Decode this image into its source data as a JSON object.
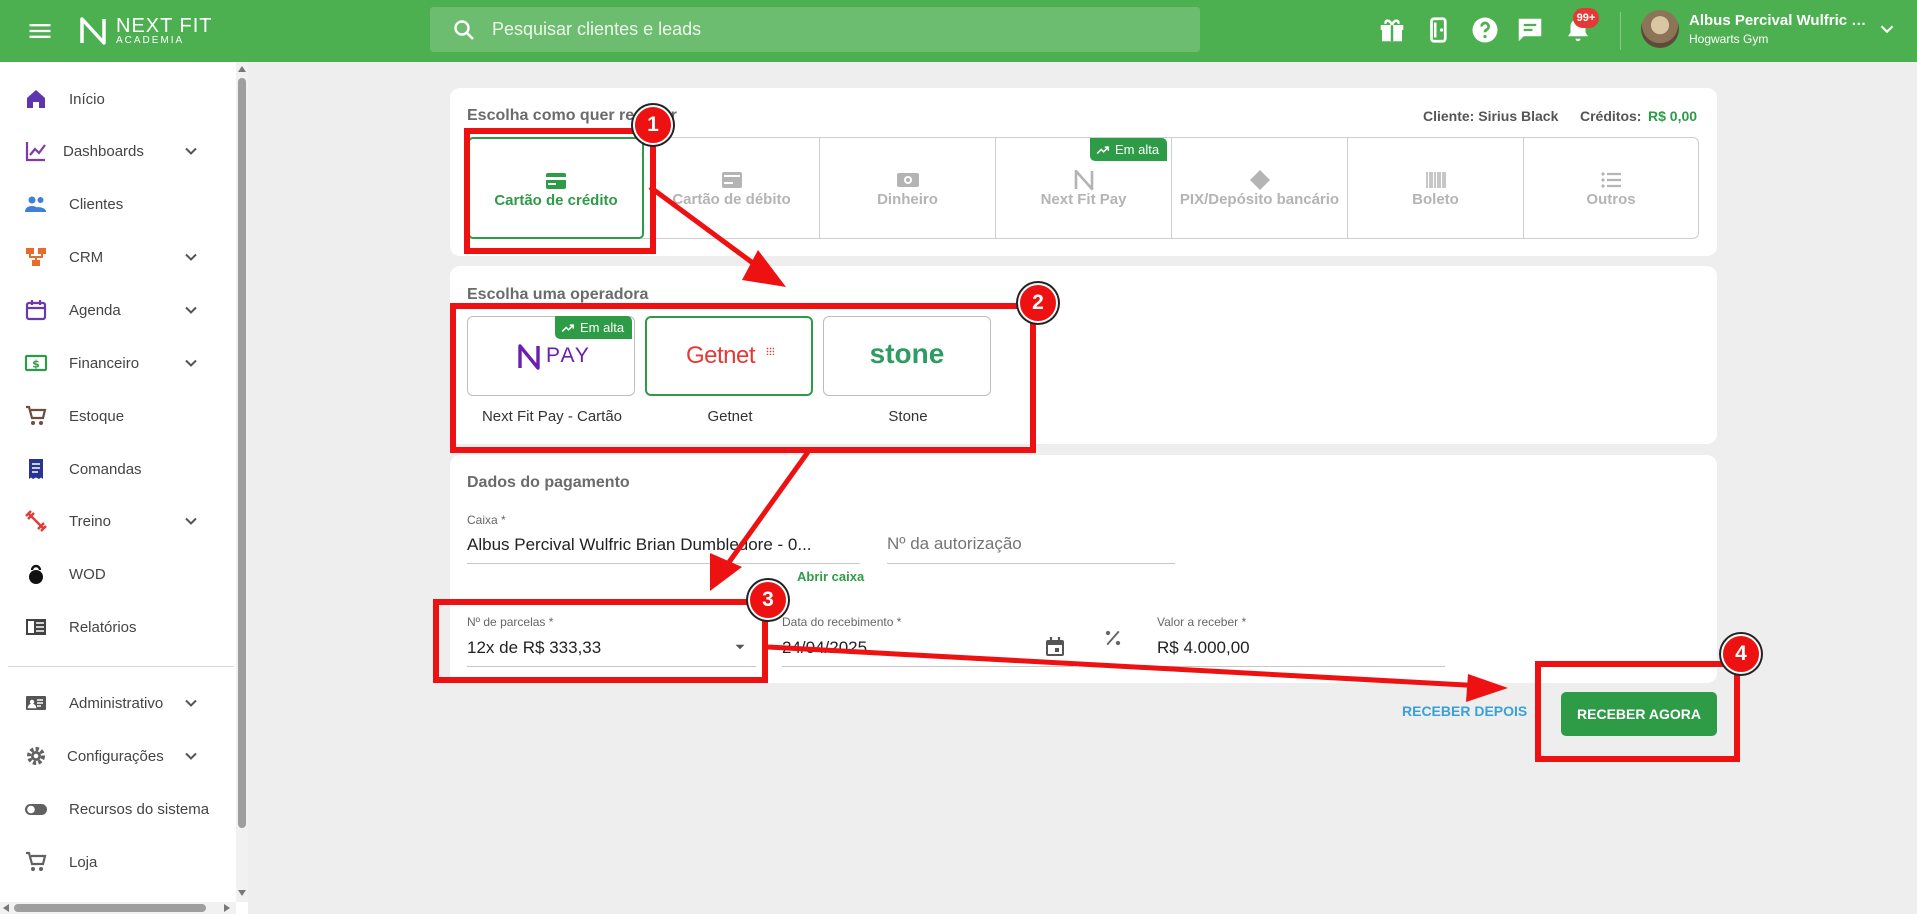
{
  "topbar": {
    "logo_main": "NEXT FIT",
    "logo_sub": "ACADEMIA",
    "search_placeholder": "Pesquisar clientes e leads",
    "notification_count": "99+",
    "user_name": "Albus Percival Wulfric Brian Dumbledore",
    "user_gym": "Hogwarts Gym"
  },
  "sidebar": {
    "items": [
      {
        "label": "Início",
        "icon": "home-icon",
        "color": "#5e35b1"
      },
      {
        "label": "Dashboards",
        "icon": "chart-line-icon",
        "color": "#7e3ba8"
      },
      {
        "label": "Clientes",
        "icon": "people-icon",
        "color": "#3f7fd9"
      },
      {
        "label": "CRM",
        "icon": "crm-icon",
        "color": "#e86b2a"
      },
      {
        "label": "Agenda",
        "icon": "calendar-icon",
        "color": "#6a3aa8"
      },
      {
        "label": "Financeiro",
        "icon": "money-icon",
        "color": "#2e9b47"
      },
      {
        "label": "Estoque",
        "icon": "cart-icon",
        "color": "#6d4c41"
      },
      {
        "label": "Comandas",
        "icon": "receipt-icon",
        "color": "#283593"
      },
      {
        "label": "Treino",
        "icon": "dumbbell-icon",
        "color": "#e53935"
      },
      {
        "label": "WOD",
        "icon": "kettlebell-icon",
        "color": "#111111"
      },
      {
        "label": "Relatórios",
        "icon": "report-icon",
        "color": "#424242"
      },
      {
        "label": "Administrativo",
        "icon": "id-card-icon",
        "color": "#555555"
      },
      {
        "label": "Configurações",
        "icon": "gear-icon",
        "color": "#616161"
      },
      {
        "label": "Recursos do sistema",
        "icon": "toggle-icon",
        "color": "#616161"
      },
      {
        "label": "Loja",
        "icon": "cart-icon",
        "color": "#616161"
      }
    ]
  },
  "payment_method": {
    "title": "Escolha como quer receber",
    "client_label": "Cliente: Sirius Black",
    "credits_label": "Créditos:",
    "credits_value": "R$ 0,00",
    "trending_label": "Em alta",
    "methods": [
      {
        "label": "Cartão de crédito",
        "icon": "credit-card-icon",
        "selected": true
      },
      {
        "label": "Cartão de débito",
        "icon": "debit-card-icon",
        "selected": false
      },
      {
        "label": "Dinheiro",
        "icon": "cash-icon",
        "selected": false
      },
      {
        "label": "Next Fit Pay",
        "icon": "nextfit-logo-icon",
        "selected": false
      },
      {
        "label": "PIX/Depósito bancário",
        "icon": "pix-icon",
        "selected": false
      },
      {
        "label": "Boleto",
        "icon": "barcode-icon",
        "selected": false
      },
      {
        "label": "Outros",
        "icon": "list-icon",
        "selected": false
      }
    ]
  },
  "operator": {
    "title": "Escolha uma operadora",
    "trending_label": "Em alta",
    "options": [
      {
        "label": "Next Fit Pay - Cartão",
        "logo_text": "PAY",
        "selected": false
      },
      {
        "label": "Getnet",
        "logo_text": "Getnet",
        "selected": true
      },
      {
        "label": "Stone",
        "logo_text": "stone",
        "selected": false
      }
    ]
  },
  "payment_data": {
    "title": "Dados do pagamento",
    "caixa_label": "Caixa *",
    "caixa_value": "Albus Percival Wulfric Brian Dumbledore - 0...",
    "auth_placeholder": "Nº da autorização",
    "open_caixa_link": "Abrir caixa",
    "installments_label": "Nº de parcelas *",
    "installments_value": "12x de R$ 333,33",
    "date_label": "Data do recebimento *",
    "date_value": "24/04/2025",
    "amount_label": "Valor a receber *",
    "amount_value": "R$ 4.000,00"
  },
  "actions": {
    "later_label": "RECEBER DEPOIS",
    "now_label": "RECEBER AGORA"
  },
  "annotations": {
    "steps": [
      "1",
      "2",
      "3",
      "4"
    ],
    "color": "#ee1111"
  }
}
